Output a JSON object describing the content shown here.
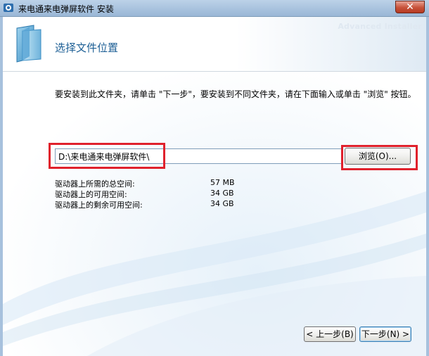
{
  "window": {
    "title": "来电通来电弹屏软件 安装",
    "close_label": "✕"
  },
  "header": {
    "brand": "Advanced Installer",
    "page_title": "选择文件位置"
  },
  "main": {
    "instruction": "要安装到此文件夹，请单击 \"下一步\"，要安装到不同文件夹，请在下面输入或单击 \"浏览\" 按钮。",
    "path_value": "D:\\来电通来电弹屏软件\\",
    "browse_label": "浏览(O)...",
    "space": [
      {
        "label": "驱动器上所需的总空间:",
        "value": "57 MB"
      },
      {
        "label": "驱动器上的可用空间:",
        "value": "34 GB"
      },
      {
        "label": "驱动器上的剩余可用空间:",
        "value": "34 GB"
      }
    ]
  },
  "footer": {
    "back_label": "< 上一步(B)",
    "next_label": "下一步(N) >"
  },
  "colors": {
    "highlight": "#e0212c",
    "title_text": "#1d5f95"
  }
}
